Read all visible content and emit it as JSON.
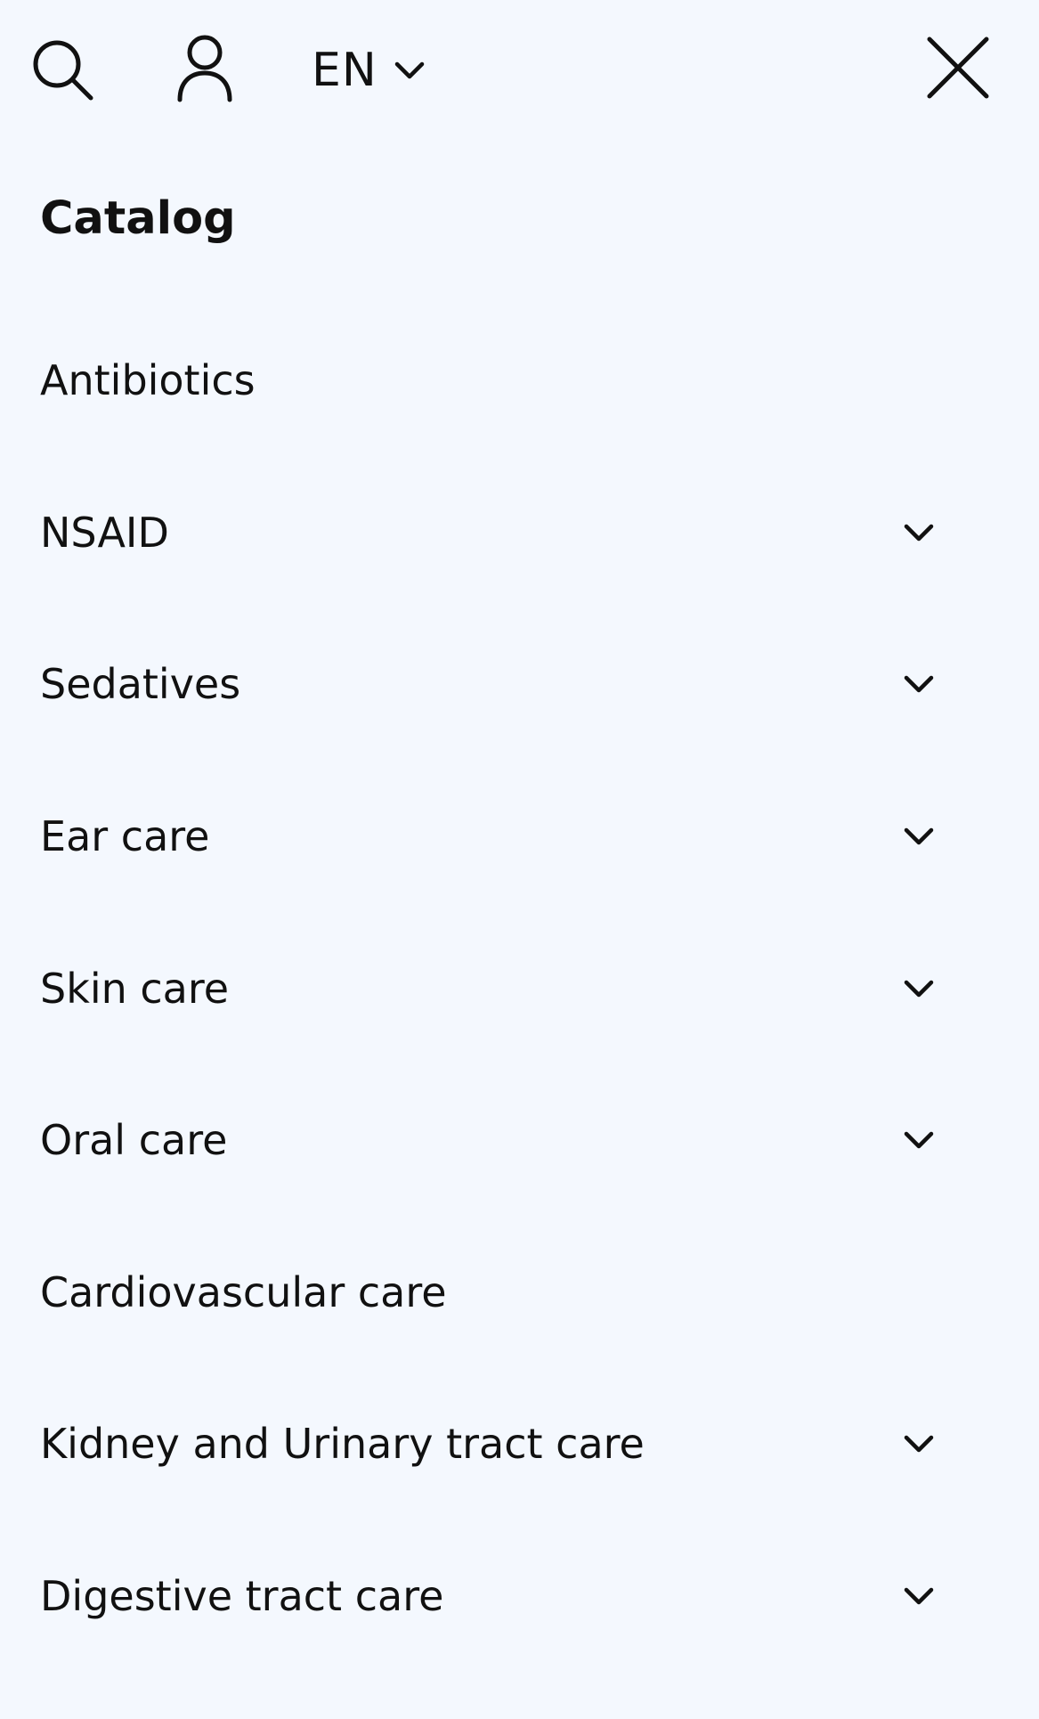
{
  "header": {
    "language": "EN",
    "icons": {
      "search": "search-icon",
      "account": "user-icon",
      "language_dropdown": "chevron-down-icon",
      "close": "close-icon"
    }
  },
  "catalog": {
    "title": "Catalog",
    "items": [
      {
        "label": "Antibiotics",
        "expandable": false
      },
      {
        "label": "NSAID",
        "expandable": true
      },
      {
        "label": "Sedatives",
        "expandable": true
      },
      {
        "label": "Ear care",
        "expandable": true
      },
      {
        "label": "Skin care",
        "expandable": true
      },
      {
        "label": "Oral care",
        "expandable": true
      },
      {
        "label": "Cardiovascular care",
        "expandable": false
      },
      {
        "label": "Kidney and Urinary tract care",
        "expandable": true
      },
      {
        "label": "Digestive tract care",
        "expandable": true
      }
    ]
  },
  "colors": {
    "background": "#f4f8fe",
    "text": "#111111"
  }
}
